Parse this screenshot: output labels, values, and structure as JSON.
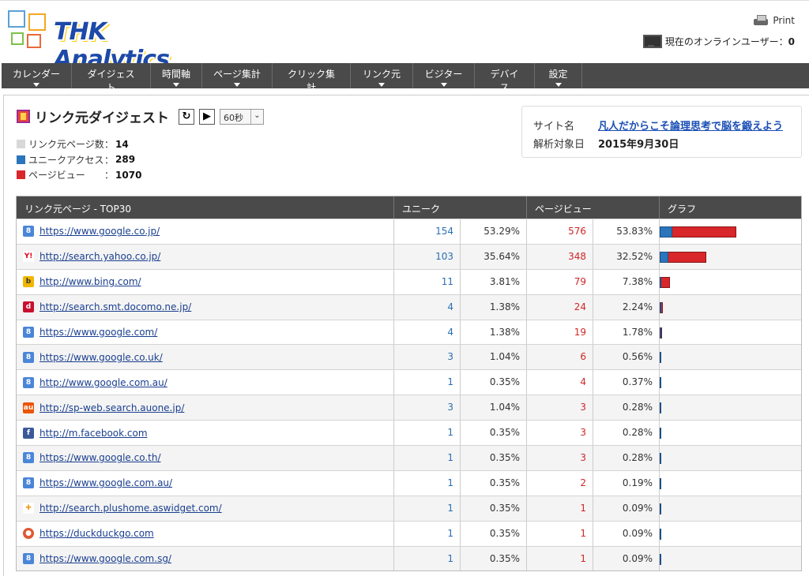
{
  "header": {
    "logo_text": "THK Analytics",
    "print_label": "Print",
    "online_label": "現在のオンラインユーザー：",
    "online_count": "0"
  },
  "nav": [
    {
      "label": "カレンダー"
    },
    {
      "label": "ダイジェスト"
    },
    {
      "label": "時間軸"
    },
    {
      "label": "ページ集計"
    },
    {
      "label": "クリック集計"
    },
    {
      "label": "リンク元"
    },
    {
      "label": "ビジター"
    },
    {
      "label": "デバイス"
    },
    {
      "label": "設定"
    }
  ],
  "page": {
    "title": "リンク元ダイジェスト",
    "refresh_icon": "refresh-icon",
    "play_icon": "play-icon",
    "interval_value": "60秒"
  },
  "legend": {
    "referrer_pages": {
      "label": "リンク元ページ数",
      "value": "14",
      "color": "#d8d8d8"
    },
    "unique_access": {
      "label": "ユニークアクセス",
      "value": "289",
      "color": "#2a75bb"
    },
    "page_views": {
      "label": "ページビュー",
      "value": "1070",
      "color": "#d8262a"
    }
  },
  "site": {
    "name_label": "サイト名",
    "name_value": "凡人だからこそ論理思考で脳を鍛えよう",
    "date_label": "解析対象日",
    "date_value": "2015年9月30日"
  },
  "table": {
    "headers": {
      "url": "リンク元ページ - TOP30",
      "unique": "ユニーク",
      "pageviews": "ページビュー",
      "graph": "グラフ"
    },
    "max_pv": 576,
    "rows": [
      {
        "icon": "google-icon",
        "url": "https://www.google.co.jp/",
        "unique": 154,
        "unique_pct": "53.29%",
        "pv": 576,
        "pv_pct": "53.83%"
      },
      {
        "icon": "yahoo-icon",
        "url": "http://search.yahoo.co.jp/",
        "unique": 103,
        "unique_pct": "35.64%",
        "pv": 348,
        "pv_pct": "32.52%"
      },
      {
        "icon": "bing-icon",
        "url": "http://www.bing.com/",
        "unique": 11,
        "unique_pct": "3.81%",
        "pv": 79,
        "pv_pct": "7.38%"
      },
      {
        "icon": "docomo-icon",
        "url": "http://search.smt.docomo.ne.jp/",
        "unique": 4,
        "unique_pct": "1.38%",
        "pv": 24,
        "pv_pct": "2.24%"
      },
      {
        "icon": "google-icon",
        "url": "https://www.google.com/",
        "unique": 4,
        "unique_pct": "1.38%",
        "pv": 19,
        "pv_pct": "1.78%"
      },
      {
        "icon": "google-icon",
        "url": "https://www.google.co.uk/",
        "unique": 3,
        "unique_pct": "1.04%",
        "pv": 6,
        "pv_pct": "0.56%"
      },
      {
        "icon": "google-icon",
        "url": "http://www.google.com.au/",
        "unique": 1,
        "unique_pct": "0.35%",
        "pv": 4,
        "pv_pct": "0.37%"
      },
      {
        "icon": "au-icon",
        "url": "http://sp-web.search.auone.jp/",
        "unique": 3,
        "unique_pct": "1.04%",
        "pv": 3,
        "pv_pct": "0.28%"
      },
      {
        "icon": "facebook-icon",
        "url": "http://m.facebook.com",
        "unique": 1,
        "unique_pct": "0.35%",
        "pv": 3,
        "pv_pct": "0.28%"
      },
      {
        "icon": "google-icon",
        "url": "https://www.google.co.th/",
        "unique": 1,
        "unique_pct": "0.35%",
        "pv": 3,
        "pv_pct": "0.28%"
      },
      {
        "icon": "google-icon",
        "url": "https://www.google.com.au/",
        "unique": 1,
        "unique_pct": "0.35%",
        "pv": 2,
        "pv_pct": "0.19%"
      },
      {
        "icon": "plushome-icon",
        "url": "http://search.plushome.aswidget.com/",
        "unique": 1,
        "unique_pct": "0.35%",
        "pv": 1,
        "pv_pct": "0.09%"
      },
      {
        "icon": "duckduckgo-icon",
        "url": "https://duckduckgo.com",
        "unique": 1,
        "unique_pct": "0.35%",
        "pv": 1,
        "pv_pct": "0.09%"
      },
      {
        "icon": "google-icon",
        "url": "https://www.google.com.sg/",
        "unique": 1,
        "unique_pct": "0.35%",
        "pv": 1,
        "pv_pct": "0.09%"
      }
    ]
  }
}
